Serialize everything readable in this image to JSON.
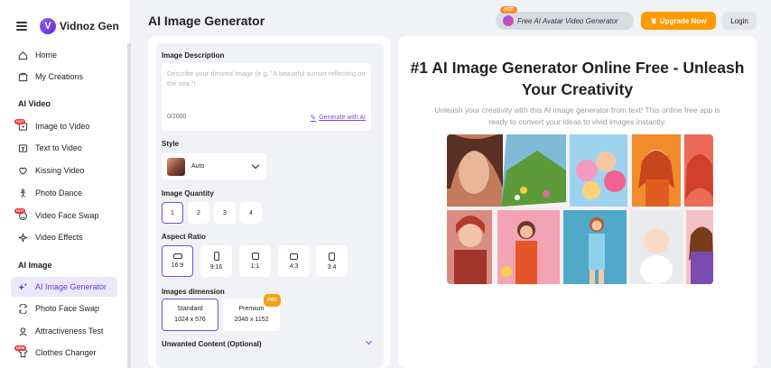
{
  "brand": {
    "name": "Vidnoz Gen",
    "mark": "V"
  },
  "sidebar": {
    "items": [
      {
        "label": "Home",
        "icon": "home-icon",
        "badge": ""
      },
      {
        "label": "My Creations",
        "icon": "folder-icon",
        "badge": ""
      }
    ],
    "sections": [
      {
        "title": "AI Video"
      },
      {
        "title": "AI Image"
      }
    ],
    "ai_video_items": [
      {
        "label": "Image to Video",
        "badge": "HOT"
      },
      {
        "label": "Text to Video",
        "badge": ""
      },
      {
        "label": "Kissing Video",
        "badge": ""
      },
      {
        "label": "Photo Dance",
        "badge": ""
      },
      {
        "label": "Video Face Swap",
        "badge": "HOT"
      },
      {
        "label": "Video Effects",
        "badge": ""
      }
    ],
    "ai_image_items": [
      {
        "label": "AI Image Generator",
        "badge": "",
        "active": true
      },
      {
        "label": "Photo Face Swap",
        "badge": ""
      },
      {
        "label": "Attractiveness Test",
        "badge": ""
      },
      {
        "label": "Clothes Changer",
        "badge": "NEW"
      }
    ]
  },
  "header": {
    "title": "AI Image Generator",
    "promo_badge": "HOT",
    "promo_text": "Free AI Avatar Video Generator",
    "upgrade_label": "Upgrade Now",
    "login_label": "Login"
  },
  "form": {
    "description_label": "Image Description",
    "description_placeholder": "Describe your desired image (e.g. \"A beautiful sunset reflecting on the sea.\")",
    "char_count": "0/2000",
    "generate_ai_label": "Generate with AI",
    "style_label": "Style",
    "style_value": "Auto",
    "quantity_label": "Image Quantity",
    "quantities": [
      "1",
      "2",
      "3",
      "4"
    ],
    "quantity_selected": "1",
    "ratio_label": "Aspect Ratio",
    "ratios": [
      "16:9",
      "9:16",
      "1:1",
      "4:3",
      "3:4"
    ],
    "ratio_selected": "16:9",
    "dimension_label": "Images dimension",
    "dimensions": [
      {
        "name": "Standard",
        "size": "1024 x 576",
        "badge": ""
      },
      {
        "name": "Premium",
        "size": "2048 x 1152",
        "badge": "PRO"
      }
    ],
    "unwanted_label": "Unwanted Content (Optional)"
  },
  "hero": {
    "title": "#1 AI Image Generator Online Free - Unleash Your Creativity",
    "subtitle": "Unleash your creativity with this AI image generator from text! This online free app is ready to convert your ideas to vivid images instantly."
  },
  "colors": {
    "accent": "#7c4ddb",
    "upgrade": "#ff9a00",
    "hot": "#ef3a3a"
  }
}
